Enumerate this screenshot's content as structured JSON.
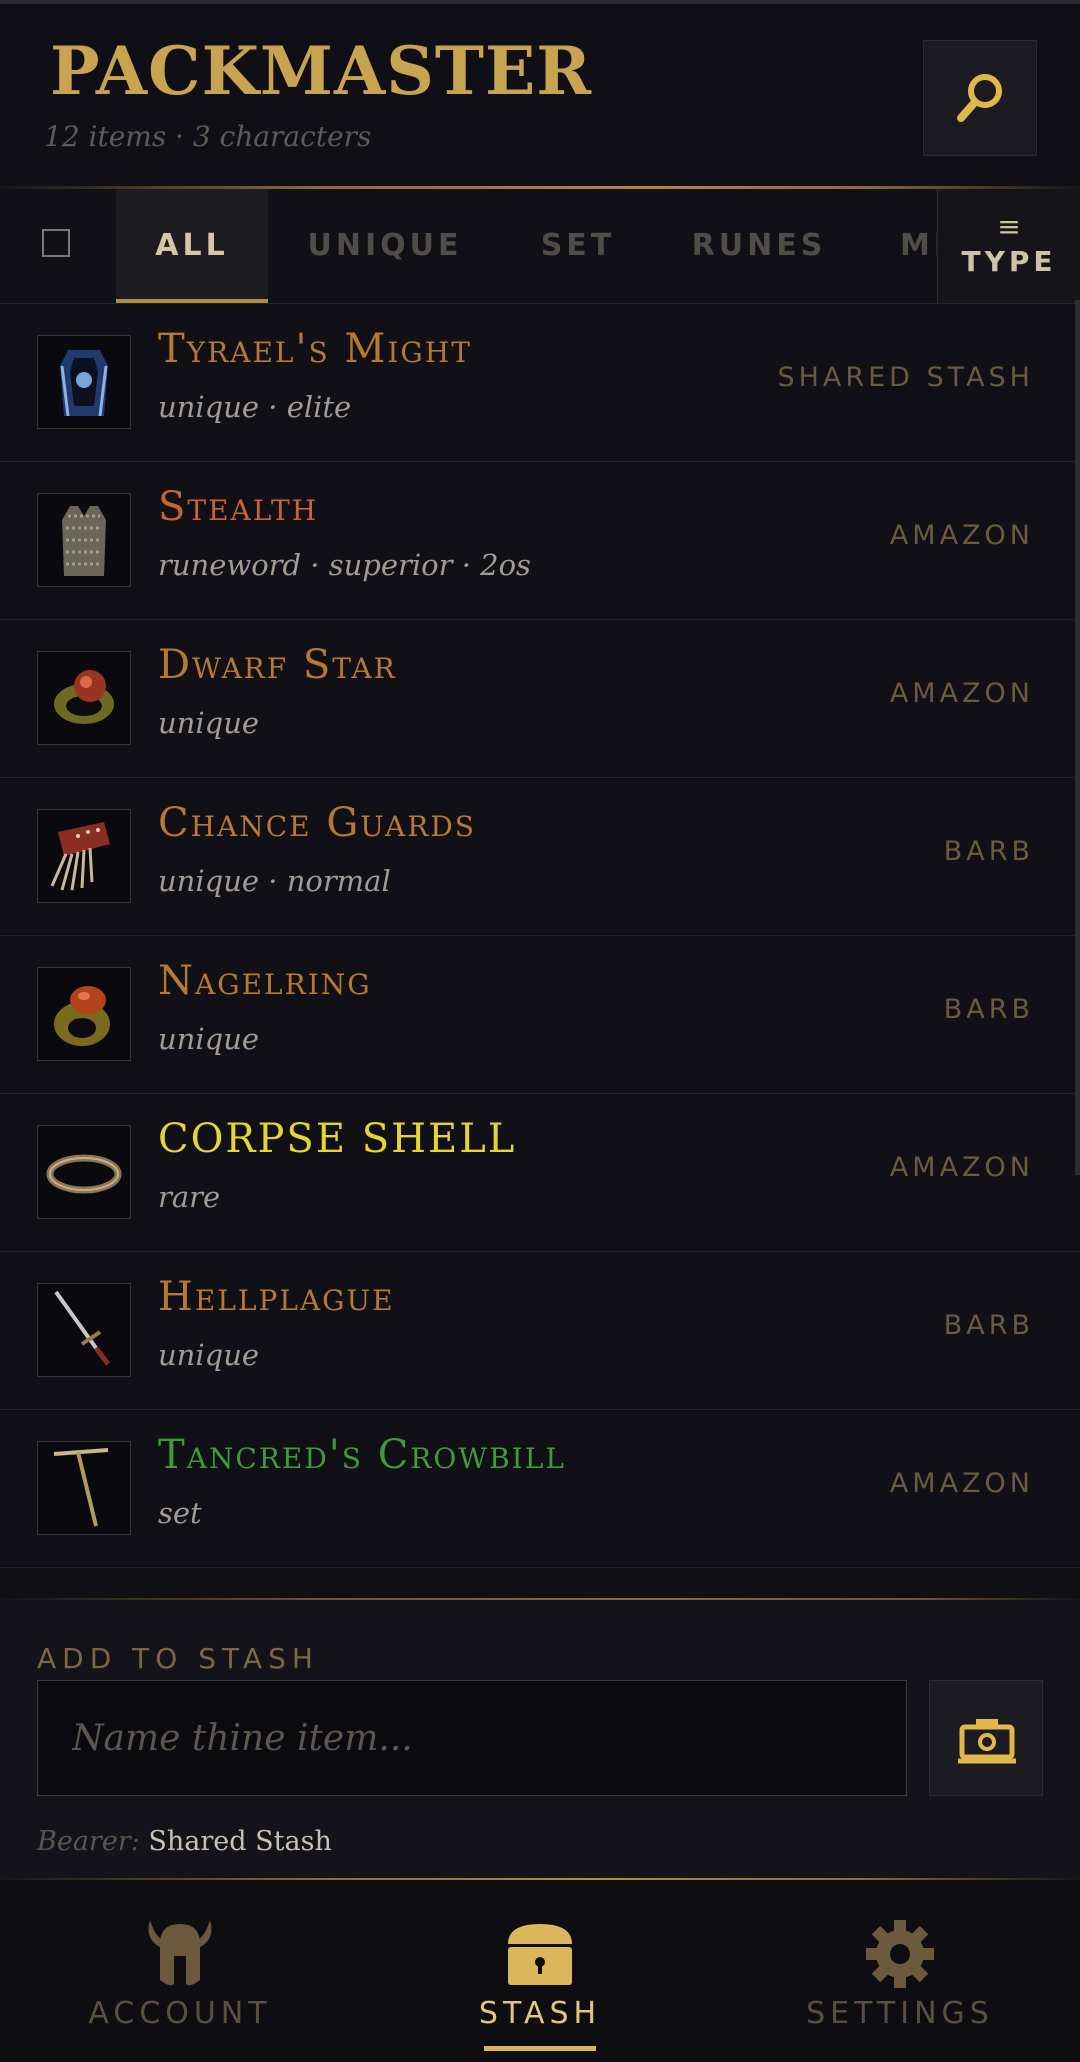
{
  "header": {
    "title": "PACKMASTER",
    "subtitle": "12 items · 3 characters",
    "search_icon": "search-icon"
  },
  "tabs": {
    "items": [
      {
        "label": "ALL",
        "active": true
      },
      {
        "label": "UNIQUE",
        "active": false
      },
      {
        "label": "SET",
        "active": false
      },
      {
        "label": "RUNES",
        "active": false
      },
      {
        "label": "MISC",
        "active": false
      }
    ],
    "type_button": {
      "label": "TYPE",
      "icon": "menu-icon"
    }
  },
  "items": [
    {
      "name": "Tyrael's Might",
      "meta": "unique · elite",
      "owner": "SHARED STASH",
      "color": "#b8782f",
      "icon": "armor-icon"
    },
    {
      "name": "Stealth",
      "meta": "runeword · superior · 2os",
      "owner": "AMAZON",
      "color": "#c8652f",
      "icon": "chainmail-icon"
    },
    {
      "name": "Dwarf Star",
      "meta": "unique",
      "owner": "AMAZON",
      "color": "#b8782f",
      "icon": "ring-icon"
    },
    {
      "name": "Chance Guards",
      "meta": "unique · normal",
      "owner": "BARB",
      "color": "#b8782f",
      "icon": "gloves-icon"
    },
    {
      "name": "Nagelring",
      "meta": "unique",
      "owner": "BARB",
      "color": "#b8782f",
      "icon": "ring-icon"
    },
    {
      "name": "CORPSE SHELL",
      "meta": "rare",
      "owner": "AMAZON",
      "color": "#e4d533",
      "icon": "circlet-icon"
    },
    {
      "name": "Hellplague",
      "meta": "unique",
      "owner": "BARB",
      "color": "#b8782f",
      "icon": "sword-icon"
    },
    {
      "name": "Tancred's Crowbill",
      "meta": "set",
      "owner": "AMAZON",
      "color": "#3f9a3c",
      "icon": "pick-icon"
    }
  ],
  "add": {
    "heading": "ADD TO STASH",
    "placeholder": "Name thine item...",
    "camera_icon": "camera-icon",
    "bearer_label": "Bearer:",
    "bearer_value": "Shared Stash"
  },
  "nav": {
    "items": [
      {
        "label": "ACCOUNT",
        "icon": "helmet-icon",
        "active": false
      },
      {
        "label": "STASH",
        "icon": "chest-icon",
        "active": true
      },
      {
        "label": "SETTINGS",
        "icon": "gear-icon",
        "active": false
      }
    ]
  },
  "colors": {
    "accent_gold": "#c8a350",
    "unique": "#b8782f",
    "runeword": "#c8652f",
    "rare": "#e4d533",
    "set": "#3f9a3c",
    "background": "#0f0f14"
  }
}
